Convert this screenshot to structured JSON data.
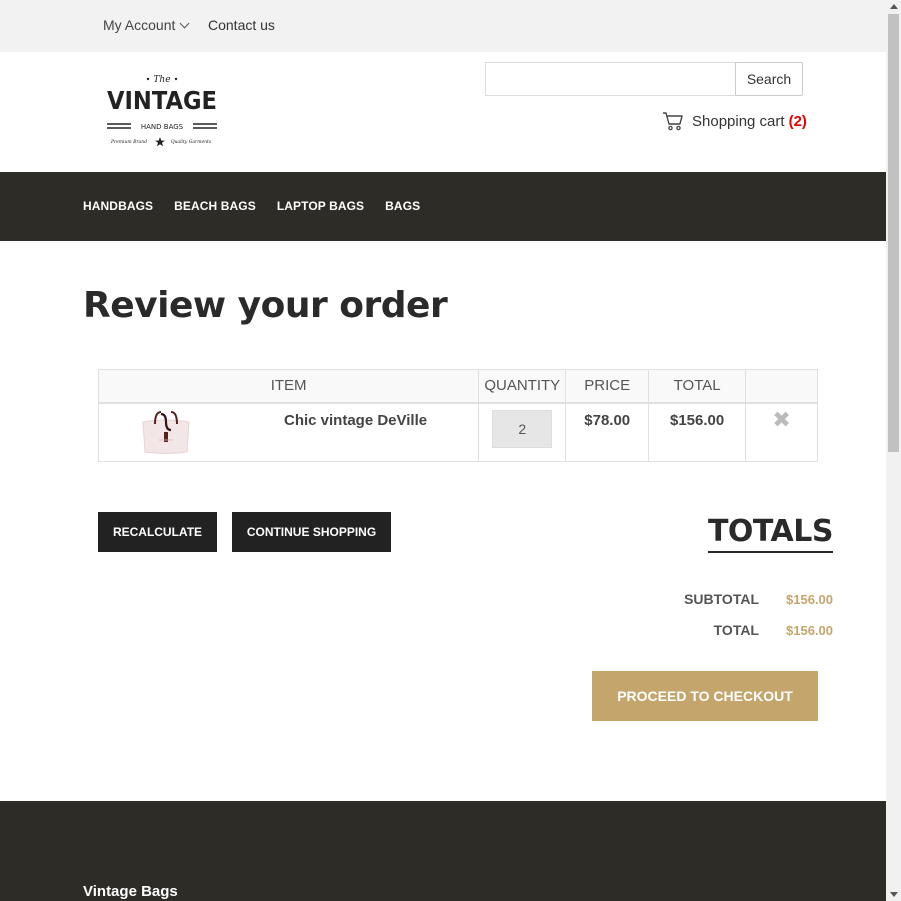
{
  "topbar": {
    "my_account": "My Account",
    "contact": "Contact us"
  },
  "logo": {
    "the": "The",
    "vintage": "VINTAGE",
    "handbags": "HAND BAGS",
    "left_tag": "Premium Brand",
    "right_tag": "Quality Garments"
  },
  "search": {
    "value": "",
    "placeholder": "",
    "button_label": "Search"
  },
  "cart": {
    "label": "Shopping cart",
    "count": "(2)"
  },
  "nav": {
    "items": [
      "HANDBAGS",
      "BEACH BAGS",
      "LAPTOP BAGS",
      "BAGS"
    ]
  },
  "page_title": "Review your order",
  "table": {
    "headers": {
      "item": "ITEM",
      "quantity": "QUANTITY",
      "price": "PRICE",
      "total": "TOTAL"
    },
    "rows": [
      {
        "name": "Chic vintage DeVille",
        "quantity": "2",
        "price": "$78.00",
        "total": "$156.00"
      }
    ]
  },
  "actions": {
    "recalculate": "RECALCULATE",
    "continue_shopping": "CONTINUE SHOPPING"
  },
  "totals": {
    "title": "TOTALS",
    "subtotal_label": "SUBTOTAL",
    "subtotal_value": "$156.00",
    "total_label": "TOTAL",
    "total_value": "$156.00",
    "checkout": "PROCEED TO CHECKOUT"
  },
  "footer": {
    "title": "Vintage Bags"
  },
  "colors": {
    "dark_bar": "#2e2c26",
    "gold_accent": "#c4a56c",
    "cart_count": "#e60000"
  }
}
